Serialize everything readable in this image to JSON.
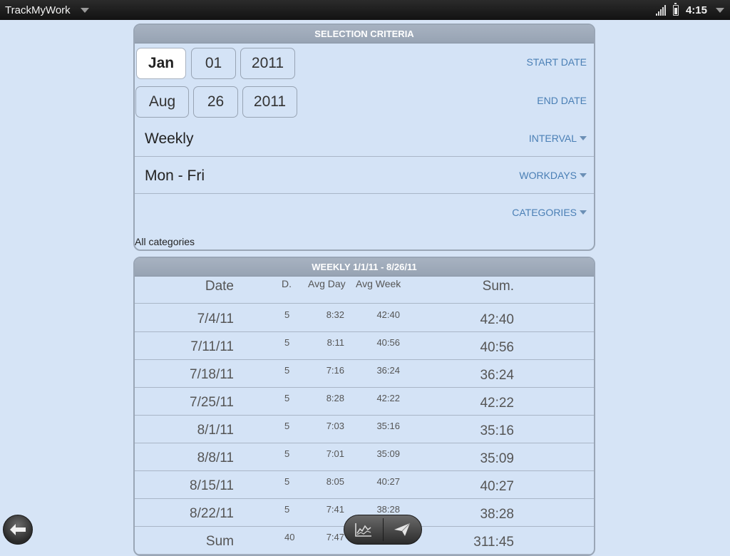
{
  "statusbar": {
    "app_title": "TrackMyWork",
    "time": "4:15"
  },
  "criteria": {
    "header": "SELECTION CRITERIA",
    "start_date": {
      "month": "Jan",
      "day": "01",
      "year": "2011",
      "label": "START DATE"
    },
    "end_date": {
      "month": "Aug",
      "day": "26",
      "year": "2011",
      "label": "END DATE"
    },
    "interval": {
      "value": "Weekly",
      "label": "INTERVAL"
    },
    "workdays": {
      "value": "Mon - Fri",
      "label": "WORKDAYS"
    },
    "categories": {
      "label": "CATEGORIES",
      "value": "All categories"
    }
  },
  "report": {
    "header": "WEEKLY 1/1/11 - 8/26/11",
    "columns": {
      "date": "Date",
      "days": "D.",
      "avg_day": "Avg Day",
      "avg_week": "Avg Week",
      "sum": "Sum."
    },
    "rows": [
      {
        "date": "7/4/11",
        "days": "5",
        "avg_day": "8:32",
        "avg_week": "42:40",
        "sum": "42:40"
      },
      {
        "date": "7/11/11",
        "days": "5",
        "avg_day": "8:11",
        "avg_week": "40:56",
        "sum": "40:56"
      },
      {
        "date": "7/18/11",
        "days": "5",
        "avg_day": "7:16",
        "avg_week": "36:24",
        "sum": "36:24"
      },
      {
        "date": "7/25/11",
        "days": "5",
        "avg_day": "8:28",
        "avg_week": "42:22",
        "sum": "42:22"
      },
      {
        "date": "8/1/11",
        "days": "5",
        "avg_day": "7:03",
        "avg_week": "35:16",
        "sum": "35:16"
      },
      {
        "date": "8/8/11",
        "days": "5",
        "avg_day": "7:01",
        "avg_week": "35:09",
        "sum": "35:09"
      },
      {
        "date": "8/15/11",
        "days": "5",
        "avg_day": "8:05",
        "avg_week": "40:27",
        "sum": "40:27"
      },
      {
        "date": "8/22/11",
        "days": "5",
        "avg_day": "7:41",
        "avg_week": "38:28",
        "sum": "38:28"
      }
    ],
    "total": {
      "date": "Sum",
      "days": "40",
      "avg_day": "7:47",
      "avg_week": "",
      "sum": "311:45"
    }
  },
  "icons": {
    "back": "back-arrow-icon",
    "chart": "chart-icon",
    "send": "send-icon",
    "app_menu": "chevron-down-icon"
  }
}
